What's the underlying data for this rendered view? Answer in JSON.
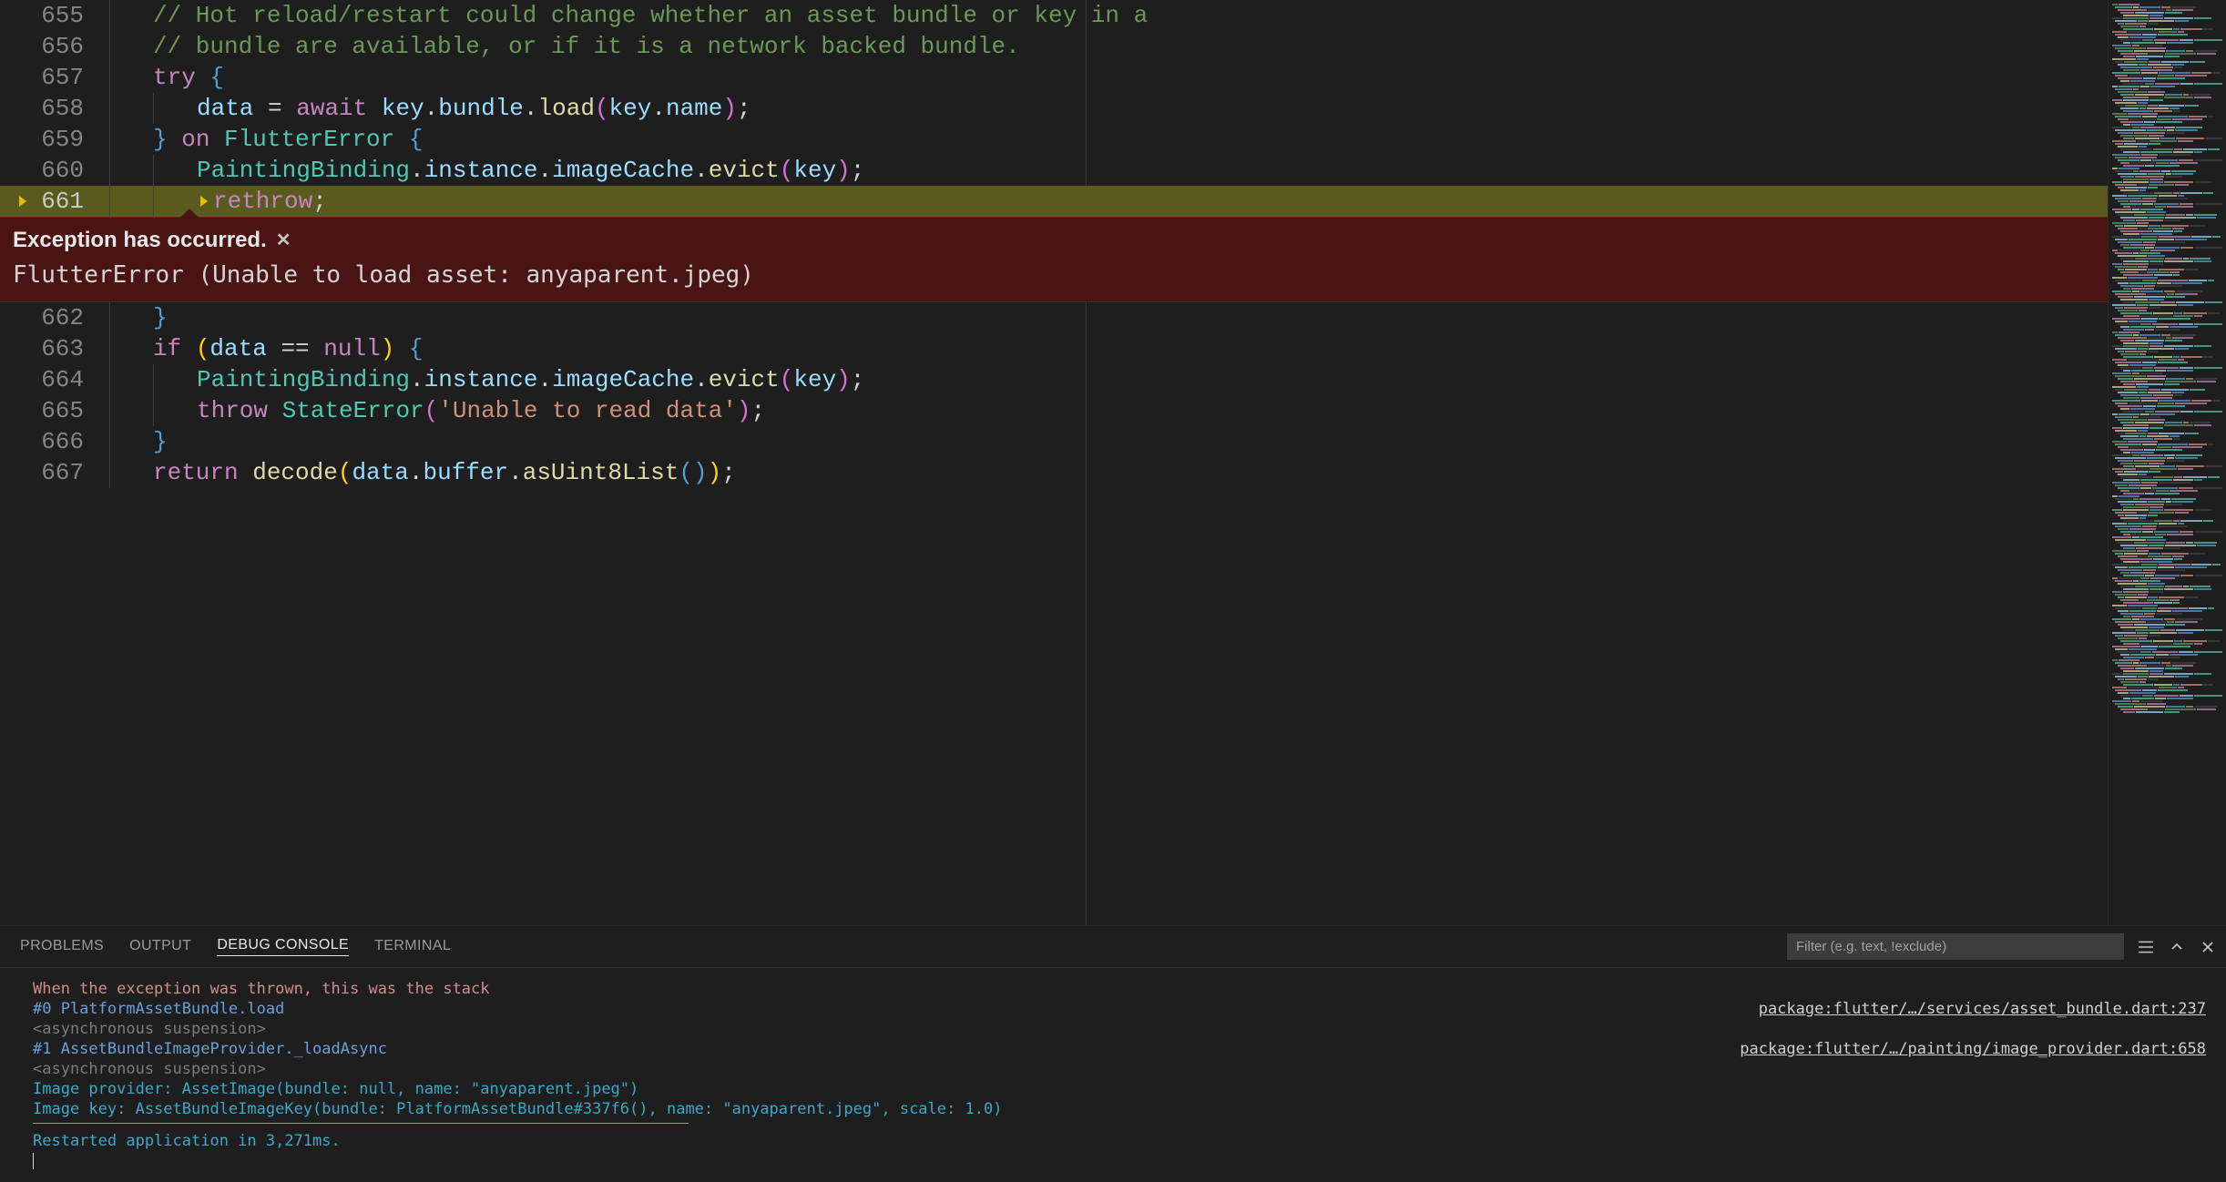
{
  "editor": {
    "ruler_cols": [
      1192
    ],
    "lines": [
      {
        "num": "655",
        "hl": false,
        "bp": false,
        "indent": 1,
        "tokens": [
          {
            "t": "// Hot reload/restart could change whether an asset bundle or key in a",
            "c": "tok-comment"
          }
        ]
      },
      {
        "num": "656",
        "hl": false,
        "bp": false,
        "indent": 1,
        "tokens": [
          {
            "t": "// bundle are available, or if it is a network backed bundle.",
            "c": "tok-comment"
          }
        ]
      },
      {
        "num": "657",
        "hl": false,
        "bp": false,
        "indent": 1,
        "tokens": [
          {
            "t": "try ",
            "c": "tok-control"
          },
          {
            "t": "{",
            "c": "tok-brace"
          }
        ]
      },
      {
        "num": "658",
        "hl": false,
        "bp": false,
        "indent": 2,
        "tokens": [
          {
            "t": "data ",
            "c": "tok-ident"
          },
          {
            "t": "= ",
            "c": "tok-op"
          },
          {
            "t": "await ",
            "c": "tok-control"
          },
          {
            "t": "key",
            "c": "tok-ident"
          },
          {
            "t": ".",
            "c": "tok-punc"
          },
          {
            "t": "bundle",
            "c": "tok-ident"
          },
          {
            "t": ".",
            "c": "tok-punc"
          },
          {
            "t": "load",
            "c": "tok-method"
          },
          {
            "t": "(",
            "c": "tok-brace2"
          },
          {
            "t": "key",
            "c": "tok-ident"
          },
          {
            "t": ".",
            "c": "tok-punc"
          },
          {
            "t": "name",
            "c": "tok-ident"
          },
          {
            "t": ")",
            "c": "tok-brace2"
          },
          {
            "t": ";",
            "c": "tok-punc"
          }
        ]
      },
      {
        "num": "659",
        "hl": false,
        "bp": false,
        "indent": 1,
        "tokens": [
          {
            "t": "} ",
            "c": "tok-brace"
          },
          {
            "t": "on ",
            "c": "tok-control"
          },
          {
            "t": "FlutterError ",
            "c": "tok-type"
          },
          {
            "t": "{",
            "c": "tok-brace"
          }
        ]
      },
      {
        "num": "660",
        "hl": false,
        "bp": false,
        "indent": 2,
        "tokens": [
          {
            "t": "PaintingBinding",
            "c": "tok-type"
          },
          {
            "t": ".",
            "c": "tok-punc"
          },
          {
            "t": "instance",
            "c": "tok-ident"
          },
          {
            "t": ".",
            "c": "tok-punc"
          },
          {
            "t": "imageCache",
            "c": "tok-ident"
          },
          {
            "t": ".",
            "c": "tok-punc"
          },
          {
            "t": "evict",
            "c": "tok-method"
          },
          {
            "t": "(",
            "c": "tok-brace2"
          },
          {
            "t": "key",
            "c": "tok-ident"
          },
          {
            "t": ")",
            "c": "tok-brace2"
          },
          {
            "t": ";",
            "c": "tok-punc"
          }
        ]
      },
      {
        "num": "661",
        "hl": true,
        "bp": true,
        "indent": 2,
        "inlinebp": true,
        "tokens": [
          {
            "t": "rethrow",
            "c": "tok-control"
          },
          {
            "t": ";",
            "c": "tok-punc"
          }
        ]
      },
      {
        "num": "__EXCEPTION__"
      },
      {
        "num": "662",
        "hl": false,
        "bp": false,
        "indent": 1,
        "tokens": [
          {
            "t": "}",
            "c": "tok-brace"
          }
        ]
      },
      {
        "num": "663",
        "hl": false,
        "bp": false,
        "indent": 1,
        "tokens": [
          {
            "t": "if ",
            "c": "tok-control"
          },
          {
            "t": "(",
            "c": "tok-brace3"
          },
          {
            "t": "data ",
            "c": "tok-ident"
          },
          {
            "t": "== ",
            "c": "tok-op"
          },
          {
            "t": "null",
            "c": "tok-keyword"
          },
          {
            "t": ") ",
            "c": "tok-brace3"
          },
          {
            "t": "{",
            "c": "tok-brace"
          }
        ]
      },
      {
        "num": "664",
        "hl": false,
        "bp": false,
        "indent": 2,
        "tokens": [
          {
            "t": "PaintingBinding",
            "c": "tok-type"
          },
          {
            "t": ".",
            "c": "tok-punc"
          },
          {
            "t": "instance",
            "c": "tok-ident"
          },
          {
            "t": ".",
            "c": "tok-punc"
          },
          {
            "t": "imageCache",
            "c": "tok-ident"
          },
          {
            "t": ".",
            "c": "tok-punc"
          },
          {
            "t": "evict",
            "c": "tok-method"
          },
          {
            "t": "(",
            "c": "tok-brace2"
          },
          {
            "t": "key",
            "c": "tok-ident"
          },
          {
            "t": ")",
            "c": "tok-brace2"
          },
          {
            "t": ";",
            "c": "tok-punc"
          }
        ]
      },
      {
        "num": "665",
        "hl": false,
        "bp": false,
        "indent": 2,
        "tokens": [
          {
            "t": "throw ",
            "c": "tok-control"
          },
          {
            "t": "StateError",
            "c": "tok-type"
          },
          {
            "t": "(",
            "c": "tok-brace2"
          },
          {
            "t": "'Unable to read data'",
            "c": "tok-str"
          },
          {
            "t": ")",
            "c": "tok-brace2"
          },
          {
            "t": ";",
            "c": "tok-punc"
          }
        ]
      },
      {
        "num": "666",
        "hl": false,
        "bp": false,
        "indent": 1,
        "tokens": [
          {
            "t": "}",
            "c": "tok-brace"
          }
        ]
      },
      {
        "num": "667",
        "hl": false,
        "bp": false,
        "indent": 1,
        "tokens": [
          {
            "t": "return ",
            "c": "tok-control"
          },
          {
            "t": "decode",
            "c": "tok-method"
          },
          {
            "t": "(",
            "c": "tok-brace3"
          },
          {
            "t": "data",
            "c": "tok-ident"
          },
          {
            "t": ".",
            "c": "tok-punc"
          },
          {
            "t": "buffer",
            "c": "tok-ident"
          },
          {
            "t": ".",
            "c": "tok-punc"
          },
          {
            "t": "asUint8List",
            "c": "tok-method"
          },
          {
            "t": "(",
            "c": "tok-brace"
          },
          {
            "t": ")",
            "c": "tok-brace"
          },
          {
            "t": ")",
            "c": "tok-brace3"
          },
          {
            "t": ";",
            "c": "tok-punc"
          }
        ]
      }
    ]
  },
  "exception": {
    "title": "Exception has occurred.",
    "message": "FlutterError (Unable to load asset: anyaparent.jpeg)"
  },
  "panel": {
    "tabs": {
      "problems": "PROBLEMS",
      "output": "OUTPUT",
      "debug": "DEBUG CONSOLE",
      "terminal": "TERMINAL"
    },
    "filter_placeholder": "Filter (e.g. text, !exclude)",
    "console": {
      "l1": "When the exception was thrown, this was the stack",
      "l2_left": "#0      PlatformAssetBundle.load",
      "l2_right": "package:flutter/…/services/asset_bundle.dart:237",
      "l3": "<asynchronous suspension>",
      "l4_left": "#1      AssetBundleImageProvider._loadAsync",
      "l4_right": "package:flutter/…/painting/image_provider.dart:658",
      "l5": "<asynchronous suspension>",
      "l6": "Image provider: AssetImage(bundle: null, name: \"anyaparent.jpeg\")",
      "l7": "Image key: AssetBundleImageKey(bundle: PlatformAssetBundle#337f6(), name: \"anyaparent.jpeg\", scale: 1.0)",
      "l8": "Restarted application in 3,271ms."
    }
  }
}
